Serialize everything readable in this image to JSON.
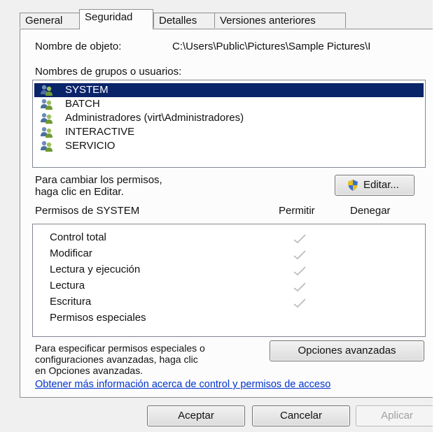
{
  "tabs": [
    {
      "label": "General"
    },
    {
      "label": "Seguridad"
    },
    {
      "label": "Detalles"
    },
    {
      "label": "Versiones anteriores"
    }
  ],
  "object": {
    "label": "Nombre de objeto:",
    "path": "C:\\Users\\Public\\Pictures\\Sample Pictures\\I"
  },
  "groups": {
    "label": "Nombres de grupos o usuarios:",
    "items": [
      {
        "name": "SYSTEM",
        "selected": true
      },
      {
        "name": "BATCH"
      },
      {
        "name": "Administradores (virt\\Administradores)"
      },
      {
        "name": "INTERACTIVE"
      },
      {
        "name": "SERVICIO"
      }
    ]
  },
  "change": {
    "line1": "Para cambiar los permisos,",
    "line2": "haga clic en Editar.",
    "edit_label": "Editar..."
  },
  "permissions": {
    "title": "Permisos de SYSTEM",
    "allow_header": "Permitir",
    "deny_header": "Denegar",
    "rows": [
      {
        "name": "Control total",
        "allow": true
      },
      {
        "name": "Modificar",
        "allow": true
      },
      {
        "name": "Lectura y ejecución",
        "allow": true
      },
      {
        "name": "Lectura",
        "allow": true
      },
      {
        "name": "Escritura",
        "allow": true
      },
      {
        "name": "Permisos especiales",
        "allow": false
      }
    ]
  },
  "advanced": {
    "line1": "Para especificar permisos especiales o",
    "line2": "configuraciones avanzadas, haga clic",
    "line3": "en Opciones avanzadas.",
    "button_label": "Opciones avanzadas",
    "link_text": "Obtener más información acerca de control y permisos de acceso"
  },
  "footer": {
    "ok_label": "Aceptar",
    "cancel_label": "Cancelar",
    "apply_label": "Aplicar"
  },
  "colors": {
    "selection": "#0a246a",
    "link": "#0033cc",
    "check": "#b9b9b9"
  }
}
